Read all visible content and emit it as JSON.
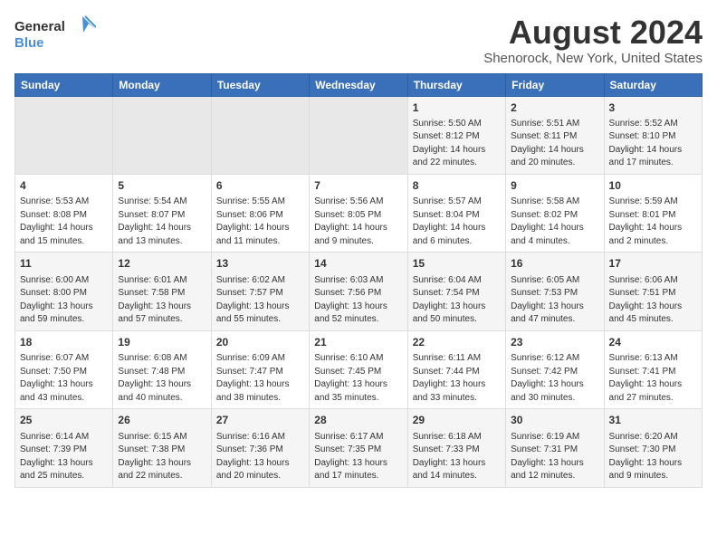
{
  "logo": {
    "line1": "General",
    "line2": "Blue"
  },
  "title": "August 2024",
  "location": "Shenorock, New York, United States",
  "days_of_week": [
    "Sunday",
    "Monday",
    "Tuesday",
    "Wednesday",
    "Thursday",
    "Friday",
    "Saturday"
  ],
  "weeks": [
    [
      {
        "day": "",
        "content": ""
      },
      {
        "day": "",
        "content": ""
      },
      {
        "day": "",
        "content": ""
      },
      {
        "day": "",
        "content": ""
      },
      {
        "day": "1",
        "content": "Sunrise: 5:50 AM\nSunset: 8:12 PM\nDaylight: 14 hours\nand 22 minutes."
      },
      {
        "day": "2",
        "content": "Sunrise: 5:51 AM\nSunset: 8:11 PM\nDaylight: 14 hours\nand 20 minutes."
      },
      {
        "day": "3",
        "content": "Sunrise: 5:52 AM\nSunset: 8:10 PM\nDaylight: 14 hours\nand 17 minutes."
      }
    ],
    [
      {
        "day": "4",
        "content": "Sunrise: 5:53 AM\nSunset: 8:08 PM\nDaylight: 14 hours\nand 15 minutes."
      },
      {
        "day": "5",
        "content": "Sunrise: 5:54 AM\nSunset: 8:07 PM\nDaylight: 14 hours\nand 13 minutes."
      },
      {
        "day": "6",
        "content": "Sunrise: 5:55 AM\nSunset: 8:06 PM\nDaylight: 14 hours\nand 11 minutes."
      },
      {
        "day": "7",
        "content": "Sunrise: 5:56 AM\nSunset: 8:05 PM\nDaylight: 14 hours\nand 9 minutes."
      },
      {
        "day": "8",
        "content": "Sunrise: 5:57 AM\nSunset: 8:04 PM\nDaylight: 14 hours\nand 6 minutes."
      },
      {
        "day": "9",
        "content": "Sunrise: 5:58 AM\nSunset: 8:02 PM\nDaylight: 14 hours\nand 4 minutes."
      },
      {
        "day": "10",
        "content": "Sunrise: 5:59 AM\nSunset: 8:01 PM\nDaylight: 14 hours\nand 2 minutes."
      }
    ],
    [
      {
        "day": "11",
        "content": "Sunrise: 6:00 AM\nSunset: 8:00 PM\nDaylight: 13 hours\nand 59 minutes."
      },
      {
        "day": "12",
        "content": "Sunrise: 6:01 AM\nSunset: 7:58 PM\nDaylight: 13 hours\nand 57 minutes."
      },
      {
        "day": "13",
        "content": "Sunrise: 6:02 AM\nSunset: 7:57 PM\nDaylight: 13 hours\nand 55 minutes."
      },
      {
        "day": "14",
        "content": "Sunrise: 6:03 AM\nSunset: 7:56 PM\nDaylight: 13 hours\nand 52 minutes."
      },
      {
        "day": "15",
        "content": "Sunrise: 6:04 AM\nSunset: 7:54 PM\nDaylight: 13 hours\nand 50 minutes."
      },
      {
        "day": "16",
        "content": "Sunrise: 6:05 AM\nSunset: 7:53 PM\nDaylight: 13 hours\nand 47 minutes."
      },
      {
        "day": "17",
        "content": "Sunrise: 6:06 AM\nSunset: 7:51 PM\nDaylight: 13 hours\nand 45 minutes."
      }
    ],
    [
      {
        "day": "18",
        "content": "Sunrise: 6:07 AM\nSunset: 7:50 PM\nDaylight: 13 hours\nand 43 minutes."
      },
      {
        "day": "19",
        "content": "Sunrise: 6:08 AM\nSunset: 7:48 PM\nDaylight: 13 hours\nand 40 minutes."
      },
      {
        "day": "20",
        "content": "Sunrise: 6:09 AM\nSunset: 7:47 PM\nDaylight: 13 hours\nand 38 minutes."
      },
      {
        "day": "21",
        "content": "Sunrise: 6:10 AM\nSunset: 7:45 PM\nDaylight: 13 hours\nand 35 minutes."
      },
      {
        "day": "22",
        "content": "Sunrise: 6:11 AM\nSunset: 7:44 PM\nDaylight: 13 hours\nand 33 minutes."
      },
      {
        "day": "23",
        "content": "Sunrise: 6:12 AM\nSunset: 7:42 PM\nDaylight: 13 hours\nand 30 minutes."
      },
      {
        "day": "24",
        "content": "Sunrise: 6:13 AM\nSunset: 7:41 PM\nDaylight: 13 hours\nand 27 minutes."
      }
    ],
    [
      {
        "day": "25",
        "content": "Sunrise: 6:14 AM\nSunset: 7:39 PM\nDaylight: 13 hours\nand 25 minutes."
      },
      {
        "day": "26",
        "content": "Sunrise: 6:15 AM\nSunset: 7:38 PM\nDaylight: 13 hours\nand 22 minutes."
      },
      {
        "day": "27",
        "content": "Sunrise: 6:16 AM\nSunset: 7:36 PM\nDaylight: 13 hours\nand 20 minutes."
      },
      {
        "day": "28",
        "content": "Sunrise: 6:17 AM\nSunset: 7:35 PM\nDaylight: 13 hours\nand 17 minutes."
      },
      {
        "day": "29",
        "content": "Sunrise: 6:18 AM\nSunset: 7:33 PM\nDaylight: 13 hours\nand 14 minutes."
      },
      {
        "day": "30",
        "content": "Sunrise: 6:19 AM\nSunset: 7:31 PM\nDaylight: 13 hours\nand 12 minutes."
      },
      {
        "day": "31",
        "content": "Sunrise: 6:20 AM\nSunset: 7:30 PM\nDaylight: 13 hours\nand 9 minutes."
      }
    ]
  ]
}
